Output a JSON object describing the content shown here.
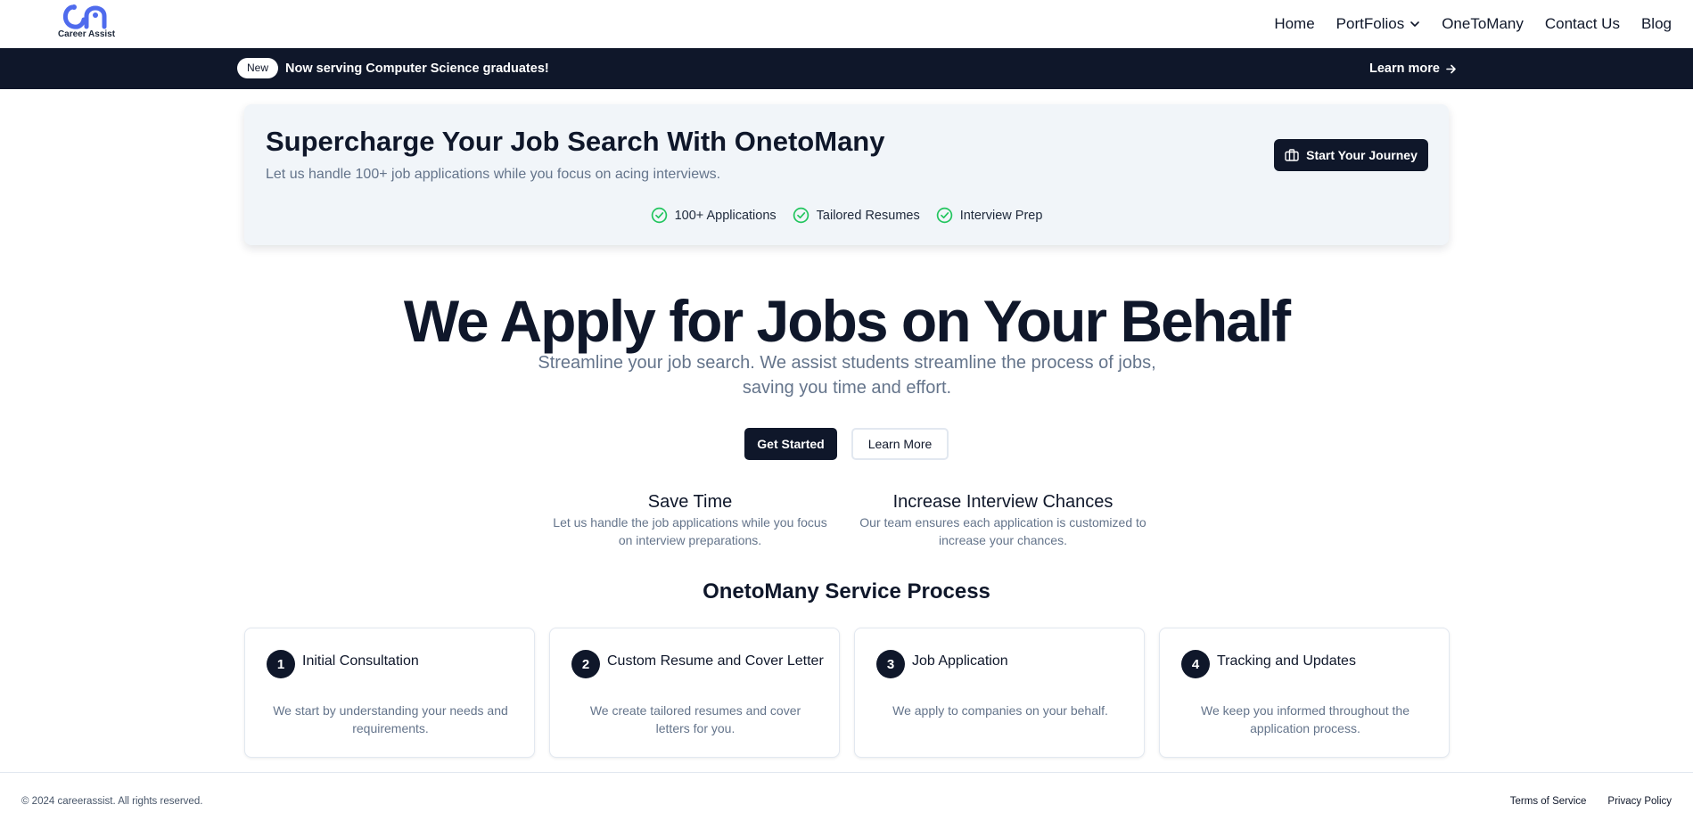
{
  "brand": {
    "name": "Career Assist",
    "accent": "#4f6bed"
  },
  "nav": {
    "items": [
      {
        "label": "Home"
      },
      {
        "label": "PortFolios",
        "has_dropdown": true
      },
      {
        "label": "OneToMany"
      },
      {
        "label": "Contact Us"
      },
      {
        "label": "Blog"
      }
    ]
  },
  "announcement": {
    "badge": "New",
    "text": "Now serving Computer Science graduates!",
    "link": "Learn more"
  },
  "promo": {
    "title": "Supercharge Your Job Search With OnetoMany",
    "subtitle": "Let us handle 100+ job applications while you focus on acing interviews.",
    "cta": "Start Your Journey",
    "features": [
      "100+ Applications",
      "Tailored Resumes",
      "Interview Prep"
    ]
  },
  "hero": {
    "title": "We Apply for Jobs on Your Behalf",
    "subtitle": "Streamline your job search. We assist students streamline the process of jobs, saving you time and effort.",
    "primary_cta": "Get Started",
    "secondary_cta": "Learn More"
  },
  "benefits": [
    {
      "title": "Save Time",
      "desc": "Let us handle the job applications while you focus on interview preparations."
    },
    {
      "title": "Increase Interview Chances",
      "desc": "Our team ensures each application is customized to increase your chances."
    }
  ],
  "process": {
    "title": "OnetoMany Service Process",
    "steps": [
      {
        "num": "1",
        "title": "Initial Consultation",
        "desc": "We start by understanding your needs and requirements."
      },
      {
        "num": "2",
        "title": "Custom Resume and Cover Letter",
        "desc": "We create tailored resumes and cover letters for you."
      },
      {
        "num": "3",
        "title": "Job Application",
        "desc": "We apply to companies on your behalf."
      },
      {
        "num": "4",
        "title": "Tracking and Updates",
        "desc": "We keep you informed throughout the application process."
      }
    ]
  },
  "footer": {
    "copyright": "© 2024 careerassist. All rights reserved.",
    "links": [
      "Terms of Service",
      "Privacy Policy"
    ]
  },
  "colors": {
    "navy": "#0f172a",
    "muted": "#64748b",
    "success": "#22c55e",
    "card_bg": "#f1f5f9"
  }
}
